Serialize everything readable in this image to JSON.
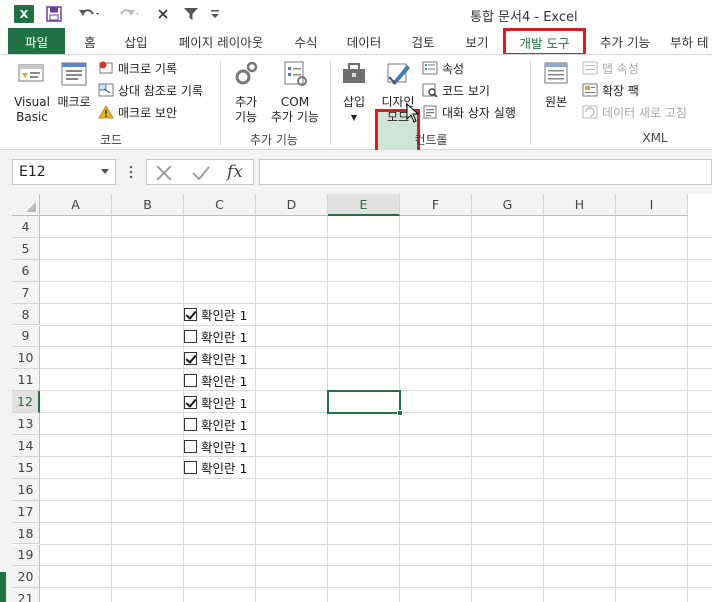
{
  "titlebar": {
    "title": "통합 문서4 - Excel",
    "logo": "X",
    "icons": [
      "excel-logo-icon",
      "save-icon",
      "undo-icon",
      "redo-icon",
      "close-x-icon",
      "filter-icon",
      "customize-qat-icon"
    ]
  },
  "tabs": [
    {
      "label": "파일"
    },
    {
      "label": "홈"
    },
    {
      "label": "삽입"
    },
    {
      "label": "페이지 레이아웃"
    },
    {
      "label": "수식"
    },
    {
      "label": "데이터"
    },
    {
      "label": "검토"
    },
    {
      "label": "보기"
    },
    {
      "label": "개발 도구"
    },
    {
      "label": "추가 기능"
    },
    {
      "label": "부하 테"
    }
  ],
  "ribbon": {
    "code": {
      "visual_basic_line1": "Visual",
      "visual_basic_line2": "Basic",
      "macros": "매크로",
      "record_macro": "매크로 기록",
      "relative_ref": "상대 참조로 기록",
      "macro_security": "매크로 보안",
      "group": "코드"
    },
    "addins": {
      "addins_line1": "추가",
      "addins_line2": "기능",
      "com_line1": "COM",
      "com_line2": "추가 기능",
      "group": "추가 기능"
    },
    "controls": {
      "insert": "삽입",
      "design_line1": "디자인",
      "design_line2": "모드",
      "properties": "속성",
      "view_code": "코드 보기",
      "run_dialog": "대화 상자 실행",
      "group": "컨트롤"
    },
    "xml": {
      "source": "원본",
      "map_properties": "맵 속성",
      "expansion_packs": "확장 팩",
      "refresh_data": "데이터 새로 고침",
      "group": "XML"
    }
  },
  "formula_bar": {
    "name_box": "E12",
    "fx": "fx",
    "formula": ""
  },
  "grid": {
    "columns": [
      "A",
      "B",
      "C",
      "D",
      "E",
      "F",
      "G",
      "H",
      "I"
    ],
    "active_column": "E",
    "rows": [
      "4",
      "5",
      "6",
      "7",
      "8",
      "9",
      "10",
      "11",
      "12",
      "13",
      "14",
      "15",
      "16",
      "17",
      "18",
      "19",
      "20",
      "21"
    ],
    "active_row": "12",
    "checkboxes": [
      {
        "row": "8",
        "label": "확인란 1",
        "checked": true
      },
      {
        "row": "9",
        "label": "확인란 1",
        "checked": false
      },
      {
        "row": "10",
        "label": "확인란 1",
        "checked": true
      },
      {
        "row": "11",
        "label": "확인란 1",
        "checked": false
      },
      {
        "row": "12",
        "label": "확인란 1",
        "checked": true
      },
      {
        "row": "13",
        "label": "확인란 1",
        "checked": false
      },
      {
        "row": "14",
        "label": "확인란 1",
        "checked": false
      },
      {
        "row": "15",
        "label": "확인란 1",
        "checked": false
      }
    ]
  },
  "colors": {
    "accent": "#217346",
    "highlight": "#d81e1e"
  }
}
